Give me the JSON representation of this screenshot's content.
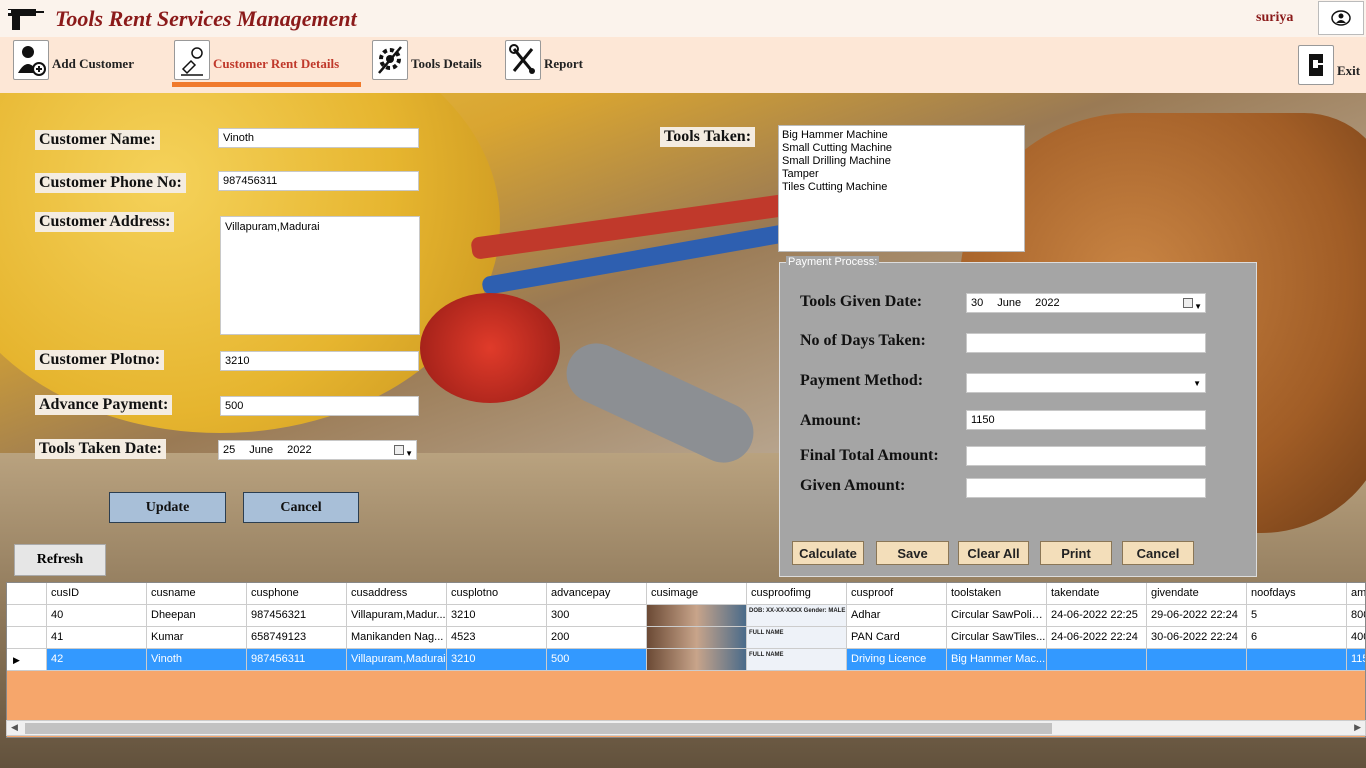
{
  "app": {
    "title": "Tools Rent Services Management",
    "user": "suriya"
  },
  "toolbar": {
    "items": [
      {
        "label": "Add Customer",
        "icon": "add-user-icon"
      },
      {
        "label": "Customer Rent Details",
        "icon": "rent-icon"
      },
      {
        "label": "Tools Details",
        "icon": "gear-icon"
      },
      {
        "label": "Report",
        "icon": "tools-icon"
      }
    ],
    "exit_label": "Exit"
  },
  "form": {
    "name_label": "Customer Name:",
    "name_value": "Vinoth",
    "phone_label": "Customer Phone No:",
    "phone_value": "987456311",
    "address_label": "Customer Address:",
    "address_value": "Villapuram,Madurai",
    "plotno_label": "Customer Plotno:",
    "plotno_value": "3210",
    "advance_label": "Advance Payment:",
    "advance_value": "500",
    "taken_date_label": "Tools Taken Date:",
    "taken_date": {
      "day": "25",
      "month": "June",
      "year": "2022"
    },
    "update_label": "Update",
    "cancel_label": "Cancel",
    "refresh_label": "Refresh"
  },
  "tools": {
    "label": "Tools Taken:",
    "items": [
      "Big Hammer Machine",
      "Small Cutting Machine",
      "Small Drilling Machine",
      "Tamper",
      "Tiles Cutting Machine"
    ]
  },
  "payment": {
    "legend": "Payment Process:",
    "given_date_label": "Tools Given Date:",
    "given_date": {
      "day": "30",
      "month": "June",
      "year": "2022"
    },
    "days_label": "No of Days Taken:",
    "days_value": "",
    "method_label": "Payment Method:",
    "method_value": "",
    "amount_label": "Amount:",
    "amount_value": "1150",
    "final_label": "Final Total Amount:",
    "final_value": "",
    "given_label": "Given Amount:",
    "given_value": "",
    "calculate_label": "Calculate",
    "save_label": "Save",
    "clear_label": "Clear All",
    "print_label": "Print",
    "cancel_label": "Cancel"
  },
  "grid": {
    "columns": [
      "cusID",
      "cusname",
      "cusphone",
      "cusaddress",
      "cusplotno",
      "advancepay",
      "cusimage",
      "cusproofimg",
      "cusproof",
      "toolstaken",
      "takendate",
      "givendate",
      "noofdays",
      "am"
    ],
    "rows": [
      [
        "40",
        "Dheepan",
        "987456321",
        "Villapuram,Madur...",
        "3210",
        "300",
        "",
        "",
        "Adhar",
        "Circular SawPolis...",
        "24-06-2022 22:25",
        "29-06-2022 22:24",
        "5",
        "800"
      ],
      [
        "41",
        "Kumar",
        "658749123",
        "Manikanden Nag...",
        "4523",
        "200",
        "",
        "",
        "PAN Card",
        "Circular SawTiles...",
        "24-06-2022 22:24",
        "30-06-2022 22:24",
        "6",
        "400"
      ],
      [
        "42",
        "Vinoth",
        "987456311",
        "Villapuram,Madurai",
        "3210",
        "500",
        "",
        "",
        "Driving Licence",
        "Big Hammer Mac...",
        "",
        "",
        "",
        "115"
      ]
    ],
    "proof_text": [
      "DOB: XX-XX-XXXX Gender: MALE",
      "FULL NAME",
      "FULL NAME"
    ],
    "selected_row": 2
  }
}
